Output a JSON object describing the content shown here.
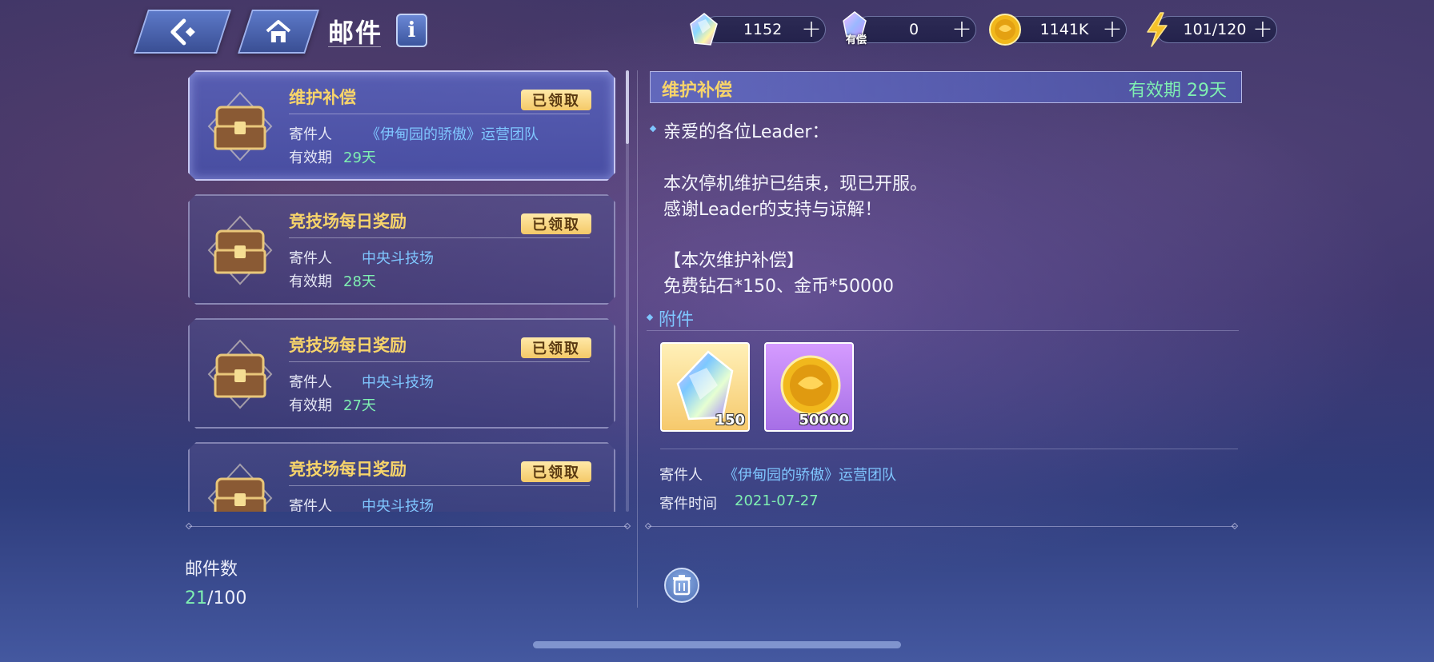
{
  "header": {
    "back_icon": "back-arrow-icon",
    "home_icon": "home-icon",
    "title": "邮件",
    "info_label": "i"
  },
  "resources": [
    {
      "name": "diamond",
      "icon": "diamond-icon",
      "value": "1152"
    },
    {
      "name": "paid-diamond",
      "icon": "paid-diamond-icon",
      "tag": "有偿",
      "value": "0"
    },
    {
      "name": "gold",
      "icon": "gold-coin-icon",
      "value": "1141K"
    },
    {
      "name": "stamina",
      "icon": "lightning-icon",
      "value": "101/120"
    }
  ],
  "plus_label": "+",
  "mails": [
    {
      "title": "维护补偿",
      "status": "已领取",
      "sender_label": "寄件人",
      "sender": "《伊甸园的骄傲》运营团队",
      "expiry_label": "有效期",
      "expiry": "29天",
      "selected": true
    },
    {
      "title": "竞技场每日奖励",
      "status": "已领取",
      "sender_label": "寄件人",
      "sender": "中央斗技场",
      "expiry_label": "有效期",
      "expiry": "28天"
    },
    {
      "title": "竞技场每日奖励",
      "status": "已领取",
      "sender_label": "寄件人",
      "sender": "中央斗技场",
      "expiry_label": "有效期",
      "expiry": "27天"
    },
    {
      "title": "竞技场每日奖励",
      "status": "已领取",
      "sender_label": "寄件人",
      "sender": "中央斗技场",
      "expiry_label": "有效期",
      "expiry": ""
    }
  ],
  "mail_count": {
    "label": "邮件数",
    "current": "21",
    "max": "/100"
  },
  "detail": {
    "title": "维护补偿",
    "expiry": "有效期  29天",
    "greeting": "亲爱的各位Leader：",
    "lines": [
      "本次停机维护已结束，现已开服。",
      "感谢Leader的支持与谅解！",
      "【本次维护补偿】",
      "免费钻石*150、金币*50000"
    ],
    "attachments_label": "附件",
    "attachments": [
      {
        "icon": "diamond-icon",
        "qty": "150"
      },
      {
        "icon": "gold-coin-icon",
        "qty": "50000"
      }
    ],
    "sender_label": "寄件人",
    "sender": "《伊甸园的骄傲》运营团队",
    "time_label": "寄件时间",
    "time": "2021-07-27",
    "delete_icon": "trash-icon"
  },
  "colors": {
    "title_gold": "#f7d46a",
    "sender_blue": "#7fc6ff",
    "expiry_green": "#7ff0b2"
  }
}
